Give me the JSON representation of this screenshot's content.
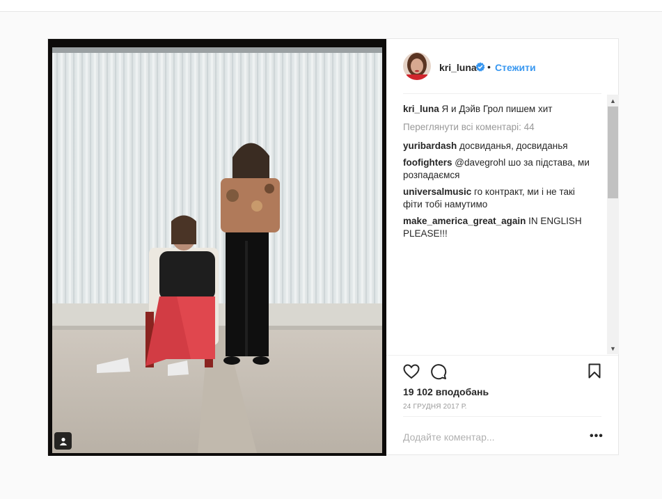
{
  "post": {
    "username": "kri_luna",
    "follow_label": "Стежити",
    "dot": "•",
    "caption_user": "kri_luna",
    "caption_text": " Я и Дэйв Грол пишем хит",
    "view_all_comments": "Переглянути всі коментарі: 44",
    "comments": [
      {
        "user": "yuribardash",
        "text": " досвиданья, досвиданья"
      },
      {
        "user": "foofighters",
        "text": " @davegrohl шо за підстава, ми розпадаємся"
      },
      {
        "user": "universalmusic",
        "text": " го контракт, ми і не такі фіти тобі намутимо"
      },
      {
        "user": "make_america_great_again",
        "text": " IN ENGLISH PLEASE!!!"
      }
    ],
    "likes": "19 102 вподобань",
    "date": "24 ГРУДНЯ 2017 Р.",
    "add_comment_placeholder": "Додайте коментар...",
    "more_label": "•••"
  },
  "colors": {
    "accent": "#3897f0",
    "text": "#262626",
    "muted": "#999999",
    "border": "#efefef",
    "background": "#fafafa"
  },
  "icons": {
    "verified": "verified-badge-icon",
    "like": "heart-icon",
    "comment": "speech-bubble-icon",
    "save": "bookmark-icon",
    "tag": "user-tag-icon"
  }
}
